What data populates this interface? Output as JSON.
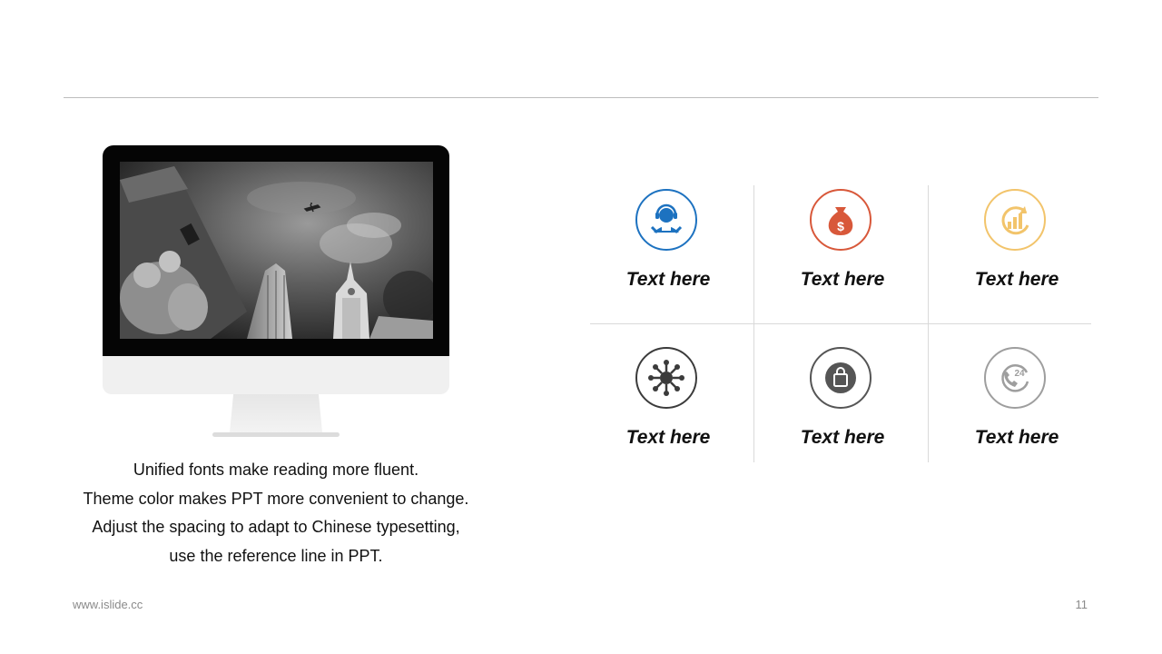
{
  "caption": {
    "line1": "Unified fonts make reading more fluent.",
    "line2": "Theme color makes PPT more convenient to change.",
    "line3": "Adjust the spacing to adapt to Chinese typesetting,",
    "line4": "use the reference  line in PPT."
  },
  "features": [
    {
      "label": "Text here",
      "icon": "user-service-icon",
      "color": "#1d72c0"
    },
    {
      "label": "Text here",
      "icon": "money-bag-icon",
      "color": "#d8583a"
    },
    {
      "label": "Text here",
      "icon": "chart-refresh-icon",
      "color": "#f2c46b"
    },
    {
      "label": "Text here",
      "icon": "network-icon",
      "color": "#3b3b3b"
    },
    {
      "label": "Text here",
      "icon": "shopping-bag-icon",
      "color": "#555555"
    },
    {
      "label": "Text here",
      "icon": "phone-24-icon",
      "color": "#9e9e9e"
    }
  ],
  "footer": {
    "website": "www.islide.cc",
    "page_number": "11"
  }
}
